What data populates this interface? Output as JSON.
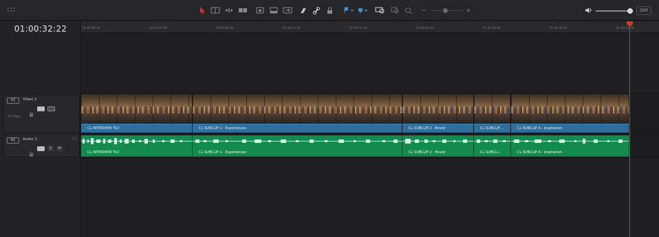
{
  "toolbar": {
    "icons": [
      "grip-icon",
      "select-tool-icon",
      "trim-tool-icon",
      "dynamic-trim-icon",
      "blade-tool-icon",
      "insert-clip-icon",
      "overwrite-clip-icon",
      "replace-clip-icon",
      "snapping-icon",
      "linked-selection-icon",
      "position-lock-icon",
      "flag-icon",
      "marker-icon",
      "zoom-full-icon",
      "zoom-detail-icon",
      "zoom-custom-icon",
      "zoom-out-icon",
      "zoom-in-icon",
      "speaker-icon"
    ],
    "zoom_level": 0.45,
    "volume_level": 0.92,
    "dim_label": "DIM",
    "accent_red": "#d9332b",
    "link_color": "#3a8fd6"
  },
  "timeline": {
    "timecode": "01:00:32:22",
    "ruler_ticks": [
      "01:00:00:00",
      "01:00:04:00",
      "01:00:08:00",
      "01:00:12:00",
      "01:00:16:00",
      "01:00:20:00",
      "01:00:24:00",
      "01:00:28:00",
      "01:00:32:00"
    ]
  },
  "tracks": {
    "video": {
      "id": "V1",
      "name": "Video 1",
      "clip_count": "5 Clips",
      "color": "#2e6f9e"
    },
    "audio": {
      "id": "A1",
      "name": "Audio 1",
      "channel": "2.0",
      "solo": "S",
      "mute": "M",
      "color": "#138a4e"
    }
  },
  "clips": {
    "video": [
      "CL INTERVIEW Tk2",
      "CL SUBCLIP 1 - Experiences",
      "CL SUBCLIP 2 - Brand",
      "CL SUBCLIP ...",
      "CL SUBCLIP 4 - Inspiration"
    ],
    "audio": [
      "CL INTERVIEW Tk2",
      "CL SUBCLIP 1 - Experiences",
      "CL SUBCLIP 2 - Brand",
      "CL SUBCLI...",
      "CL SUBCLIP 4 - Inspiration"
    ]
  }
}
